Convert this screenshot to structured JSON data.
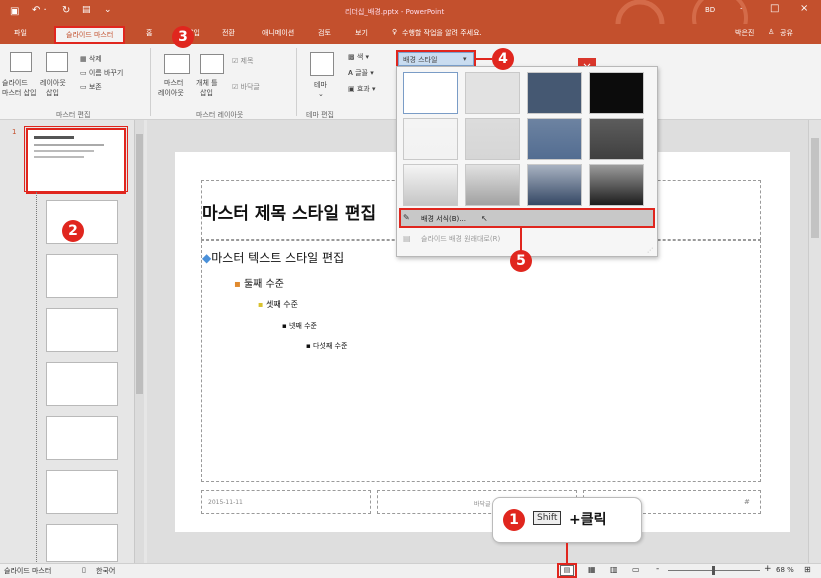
{
  "titlebar": {
    "title": "리더십_배경.pptx - PowerPoint",
    "user_abbr": "BD"
  },
  "tabs": [
    {
      "label": "파일"
    },
    {
      "label": "슬라이드 마스터"
    },
    {
      "label": "홈"
    },
    {
      "label": "삽입"
    },
    {
      "label": "전환"
    },
    {
      "label": "애니메이션"
    },
    {
      "label": "검토"
    },
    {
      "label": "보기"
    }
  ],
  "tellme": "수행할 작업을 알려 주세요.",
  "account": {
    "name": "박은진",
    "share": "공유"
  },
  "ribbon": {
    "insert_master": "슬라이드 마스터 삽입",
    "insert_master_l1": "슬라이드",
    "insert_master_l2": "마스터 삽입",
    "insert_layout_l1": "레이아웃",
    "insert_layout_l2": "삽입",
    "delete": "삭제",
    "rename": "이름 바꾸기",
    "preserve": "보존",
    "group_master_edit": "마스터 편집",
    "master_layout_l1": "마스터",
    "master_layout_l2": "레이아웃",
    "insert_placeholder_l1": "개체 틀",
    "insert_placeholder_l2": "삽입",
    "chk_title": "제목",
    "chk_footer": "바닥글",
    "group_master_layout": "마스터 레이아웃",
    "theme_l1": "테마",
    "group_theme_edit": "테마 편집",
    "colors": "색",
    "fonts": "글꼴",
    "effects": "효과",
    "bg_styles": "배경 스타일"
  },
  "dropdown": {
    "swatch_colors": [
      "#ffffff",
      "#e2e2e2",
      "#455872",
      "#0c0c0c",
      "#f2f2f2",
      "#d6d6d6",
      "#536d91",
      "#404040",
      "#e8e8e8",
      "#bdbdbd",
      "#3e5476",
      "#222222"
    ],
    "format_background": "배경 서식(B)...",
    "reset_background": "슬라이드 배경 원래대로(R)"
  },
  "slide": {
    "title": "마스터 제목 스타일 편집",
    "l1": "마스터 텍스트 스타일 편집",
    "l2": "둘째 수준",
    "l3": "셋째 수준",
    "l4": "넷째 수준",
    "l5": "다섯째 수준",
    "date": "2015-11-11",
    "footer": "바닥글"
  },
  "callouts": {
    "c1": "1",
    "c2": "2",
    "c3": "3",
    "c4": "4",
    "c5": "5",
    "shift_label": "Shift",
    "click_label": "+클릭"
  },
  "status": {
    "view_name": "슬라이드 마스터",
    "language": "한국어",
    "zoom": "68 %"
  },
  "thumb_count": 1
}
